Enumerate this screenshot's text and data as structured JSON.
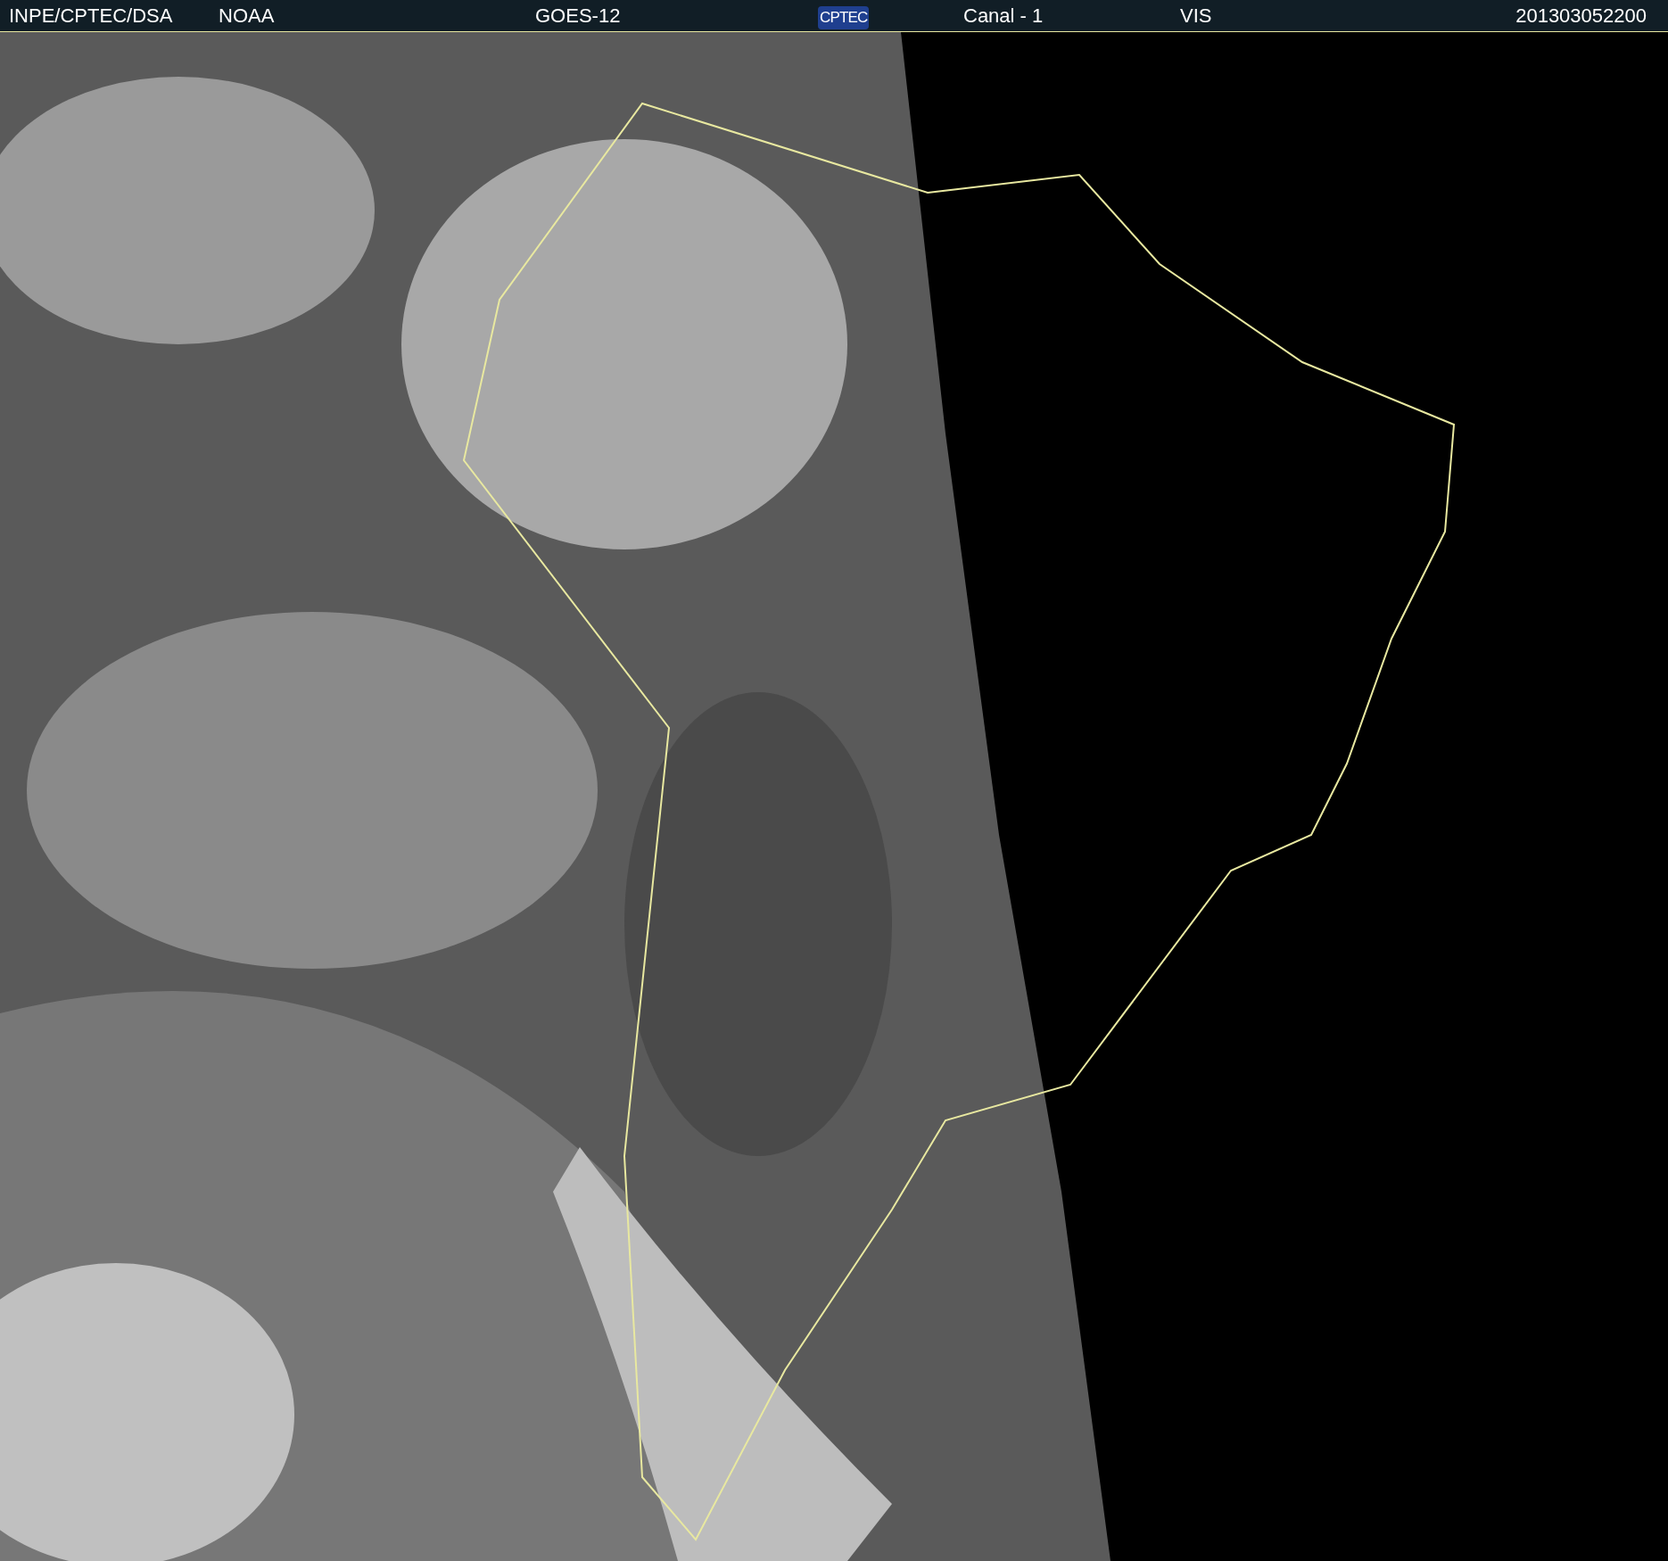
{
  "header": {
    "source": "INPE/CPTEC/DSA",
    "agency": "NOAA",
    "satellite": "GOES-12",
    "logo": "CPTEC",
    "channel": "Canal - 1",
    "band": "VIS",
    "timestamp": "201303052200"
  }
}
